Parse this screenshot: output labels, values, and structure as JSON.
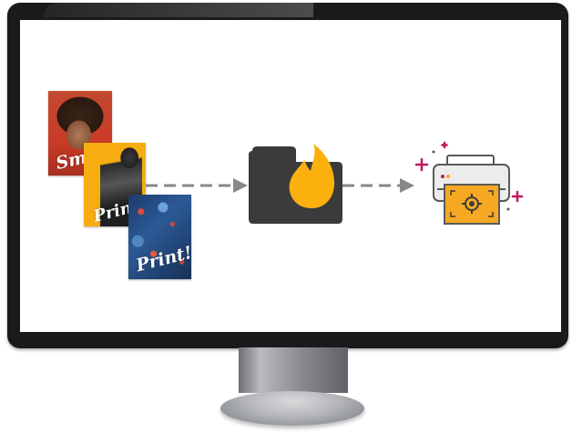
{
  "photos": [
    {
      "caption": "Smile!"
    },
    {
      "caption": "Print!"
    },
    {
      "caption": "Print!"
    }
  ],
  "colors": {
    "bezel": "#1a1a1c",
    "folder": "#3b3b3b",
    "flame": "#fbb00e",
    "printer_body": "#ececec",
    "printer_outline": "#5a5a5a",
    "paper": "#f7a823",
    "sparkle": "#c2185b",
    "arrow": "#888888"
  },
  "icons": [
    "folder-icon",
    "flame-icon",
    "printer-icon",
    "target-icon",
    "sparkle-icon"
  ]
}
